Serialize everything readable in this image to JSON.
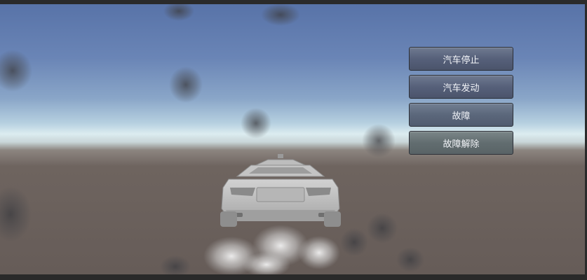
{
  "controls": {
    "stop_label": "汽车停止",
    "start_label": "汽车发动",
    "fault_label": "故障",
    "fault_clear_label": "故障解除"
  }
}
